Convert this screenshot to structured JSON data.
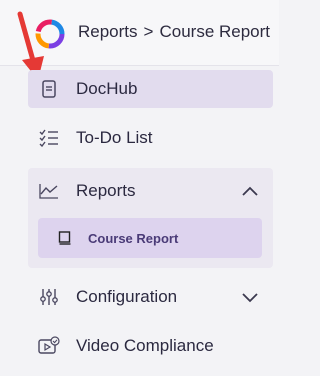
{
  "header": {
    "breadcrumb": [
      "Reports",
      "Course Report"
    ],
    "separator": ">"
  },
  "sidebar": {
    "items": [
      {
        "label": "DocHub",
        "icon": "document-icon",
        "active": true
      },
      {
        "label": "To-Do List",
        "icon": "checklist-icon"
      },
      {
        "label": "Reports",
        "icon": "line-chart-icon",
        "expanded": true,
        "children": [
          {
            "label": "Course Report",
            "icon": "book-icon",
            "active": true
          }
        ]
      },
      {
        "label": "Configuration",
        "icon": "sliders-icon",
        "expanded": false
      },
      {
        "label": "Video Compliance",
        "icon": "video-check-icon"
      }
    ]
  },
  "colors": {
    "active_bg": "#e2dcee",
    "group_bg": "#ebe8f1",
    "sub_active_bg": "#ddd3ee",
    "annotation_arrow": "#e53935"
  }
}
